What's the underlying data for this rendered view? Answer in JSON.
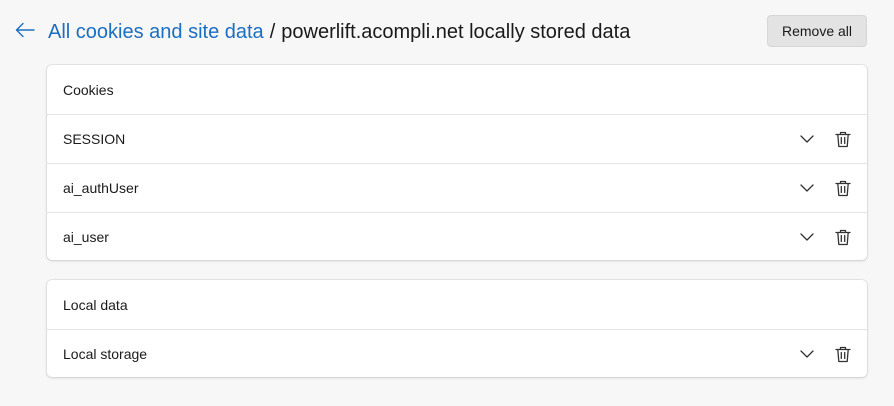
{
  "header": {
    "back_icon": "arrow-left-icon",
    "breadcrumb_link": "All cookies and site data",
    "separator": "/",
    "current_page": "powerlift.acompli.net locally stored data",
    "remove_all_label": "Remove all"
  },
  "sections": [
    {
      "title": "Cookies",
      "items": [
        {
          "label": "SESSION"
        },
        {
          "label": "ai_authUser"
        },
        {
          "label": "ai_user"
        }
      ]
    },
    {
      "title": "Local data",
      "items": [
        {
          "label": "Local storage"
        }
      ]
    }
  ],
  "icons": {
    "expand": "chevron-down-icon",
    "delete": "trash-icon"
  },
  "colors": {
    "link": "#1b6ec2",
    "background": "#f7f7f7",
    "button": "#e3e3e3"
  }
}
